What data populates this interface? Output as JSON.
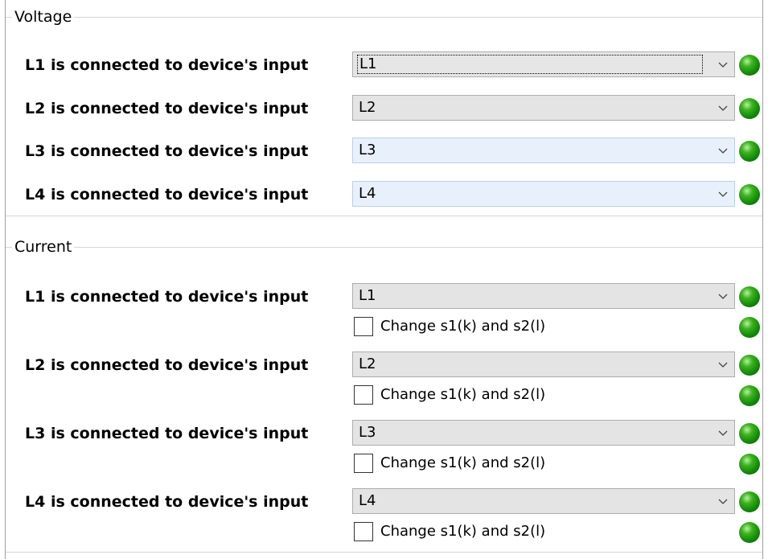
{
  "voltage": {
    "title": "Voltage",
    "rows": [
      {
        "label": "L1 is connected to device's input",
        "value": "L1"
      },
      {
        "label": "L2 is connected to device's input",
        "value": "L2"
      },
      {
        "label": "L3 is connected to device's input",
        "value": "L3"
      },
      {
        "label": "L4 is connected to device's input",
        "value": "L4"
      }
    ]
  },
  "current": {
    "title": "Current",
    "rows": [
      {
        "label": "L1 is connected to device's input",
        "value": "L1",
        "checkbox_label": "Change s1(k) and s2(l)",
        "checked": false
      },
      {
        "label": "L2 is connected to device's input",
        "value": "L2",
        "checkbox_label": "Change s1(k) and s2(l)",
        "checked": false
      },
      {
        "label": "L3 is connected to device's input",
        "value": "L3",
        "checkbox_label": "Change s1(k) and s2(l)",
        "checked": false
      },
      {
        "label": "L4 is connected to device's input",
        "value": "L4",
        "checkbox_label": "Change s1(k) and s2(l)",
        "checked": false
      }
    ]
  },
  "status": {
    "led_color": "#1e9a12"
  }
}
